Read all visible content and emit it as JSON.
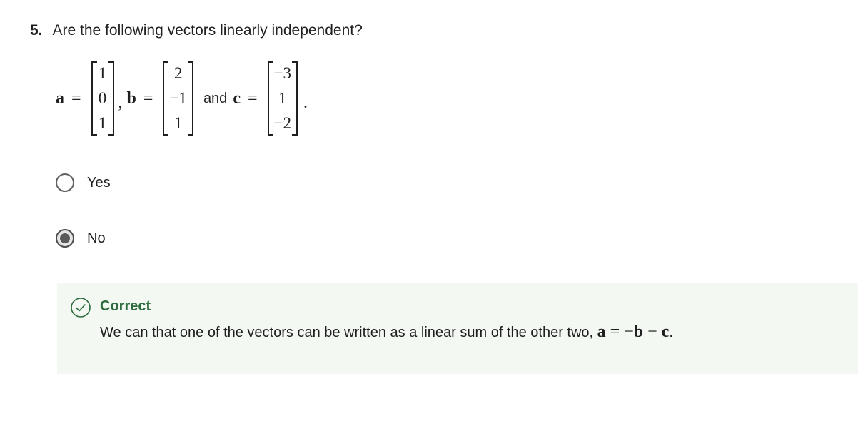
{
  "question": {
    "number": "5.",
    "text": "Are the following vectors linearly independent?"
  },
  "vectors": {
    "a": {
      "name": "a",
      "values": [
        "1",
        "0",
        "1"
      ]
    },
    "b": {
      "name": "b",
      "values": [
        "2",
        "−1",
        "1"
      ]
    },
    "c": {
      "name": "c",
      "values": [
        "−3",
        "1",
        "−2"
      ]
    },
    "equals": "=",
    "comma": ",",
    "and_text": "and",
    "period": "."
  },
  "options": [
    {
      "label": "Yes",
      "selected": false
    },
    {
      "label": "No",
      "selected": true
    }
  ],
  "feedback": {
    "title": "Correct",
    "text": "We can that one of the vectors can be written as a linear sum of the other two, ",
    "equation": {
      "lhs": "a",
      "eq": " = ",
      "neg": "−",
      "b": "b",
      "minus": " − ",
      "c": "c",
      "end": "."
    },
    "title_color": "#2e6b3c",
    "background": "#f3f8f3"
  }
}
